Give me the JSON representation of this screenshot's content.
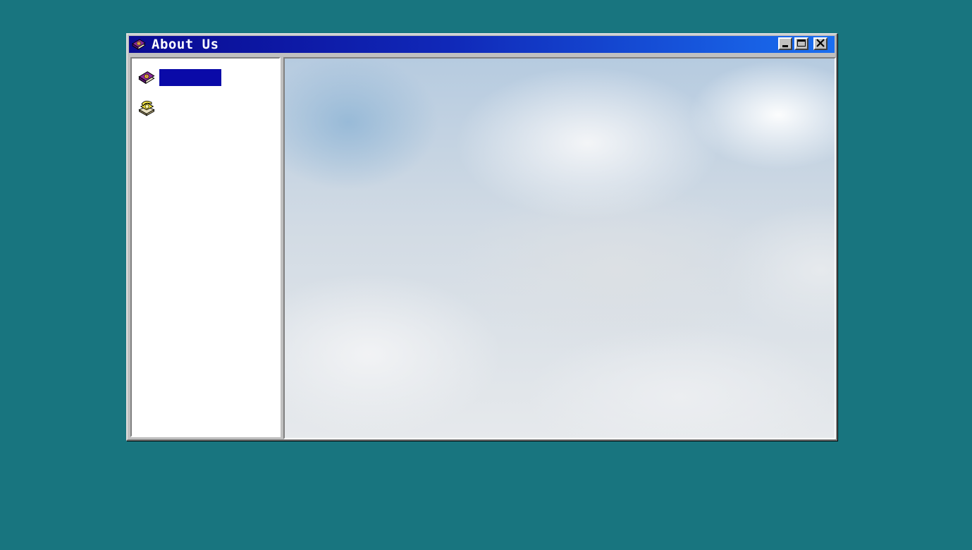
{
  "window": {
    "title": "About Us",
    "title_icon": "book-icon",
    "buttons": {
      "minimize_icon": "minimize-icon",
      "maximize_icon": "maximize-icon",
      "close_icon": "close-icon"
    }
  },
  "sidebar": {
    "items": [
      {
        "icon": "book-icon",
        "label": "",
        "selected": true
      },
      {
        "icon": "telephone-icon",
        "label": "",
        "selected": false
      }
    ]
  },
  "content": {
    "image": "cloud-sky-image"
  },
  "colors": {
    "desktop": "#18757f",
    "titlebar_start": "#0a0a92",
    "titlebar_end": "#1a6ff0",
    "selection": "#0a0aa8",
    "window_face": "#c0c0c0"
  }
}
